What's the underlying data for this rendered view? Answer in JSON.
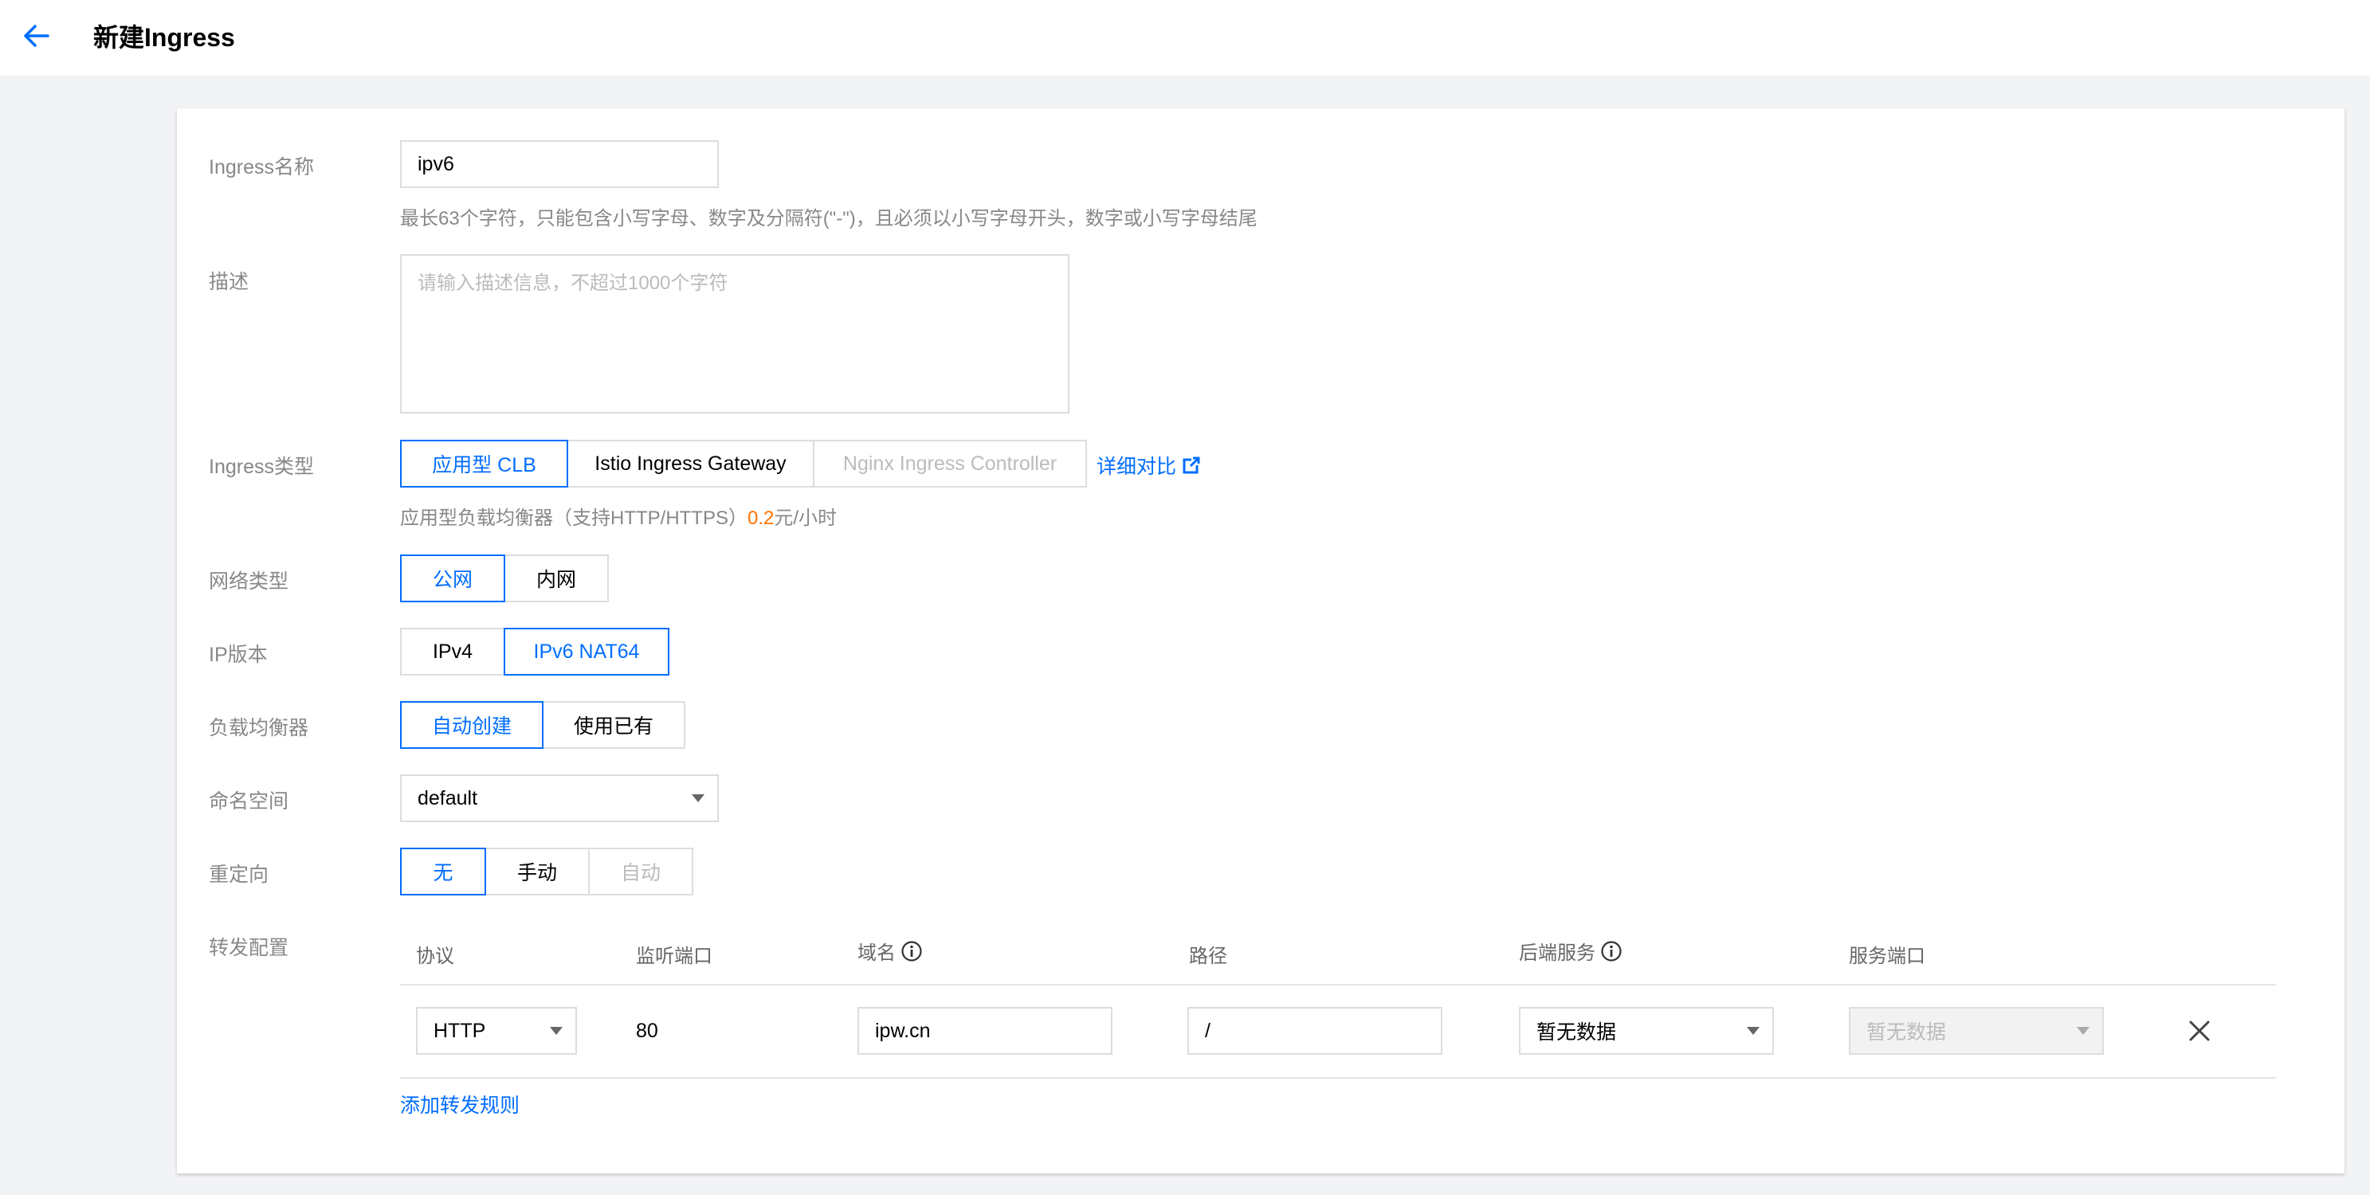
{
  "header": {
    "title": "新建Ingress"
  },
  "form": {
    "name": {
      "label": "Ingress名称",
      "value": "ipv6",
      "hint": "最长63个字符，只能包含小写字母、数字及分隔符(\"-\")，且必须以小写字母开头，数字或小写字母结尾"
    },
    "description": {
      "label": "描述",
      "placeholder": "请输入描述信息，不超过1000个字符"
    },
    "ingress_type": {
      "label": "Ingress类型",
      "options": [
        "应用型 CLB",
        "Istio Ingress Gateway",
        "Nginx Ingress Controller"
      ],
      "selected": "应用型 CLB",
      "compare_link": "详细对比",
      "hint_prefix": "应用型负载均衡器（支持HTTP/HTTPS）",
      "price": "0.2",
      "price_unit": "元/小时"
    },
    "network_type": {
      "label": "网络类型",
      "options": [
        "公网",
        "内网"
      ],
      "selected": "公网"
    },
    "ip_version": {
      "label": "IP版本",
      "options": [
        "IPv4",
        "IPv6 NAT64"
      ],
      "selected": "IPv6 NAT64"
    },
    "load_balancer": {
      "label": "负载均衡器",
      "options": [
        "自动创建",
        "使用已有"
      ],
      "selected": "自动创建"
    },
    "namespace": {
      "label": "命名空间",
      "value": "default"
    },
    "redirect": {
      "label": "重定向",
      "options": [
        "无",
        "手动",
        "自动"
      ],
      "selected": "无",
      "disabled": "自动"
    },
    "forwarding": {
      "label": "转发配置",
      "columns": [
        "协议",
        "监听端口",
        "域名",
        "路径",
        "后端服务",
        "服务端口"
      ],
      "rows": [
        {
          "protocol": "HTTP",
          "port": "80",
          "domain": "ipw.cn",
          "path": "/",
          "backend_service": "暂无数据",
          "service_port": "暂无数据"
        }
      ],
      "add_rule": "添加转发规则"
    }
  },
  "colors": {
    "accent": "#006eff",
    "price": "#ff7200"
  }
}
